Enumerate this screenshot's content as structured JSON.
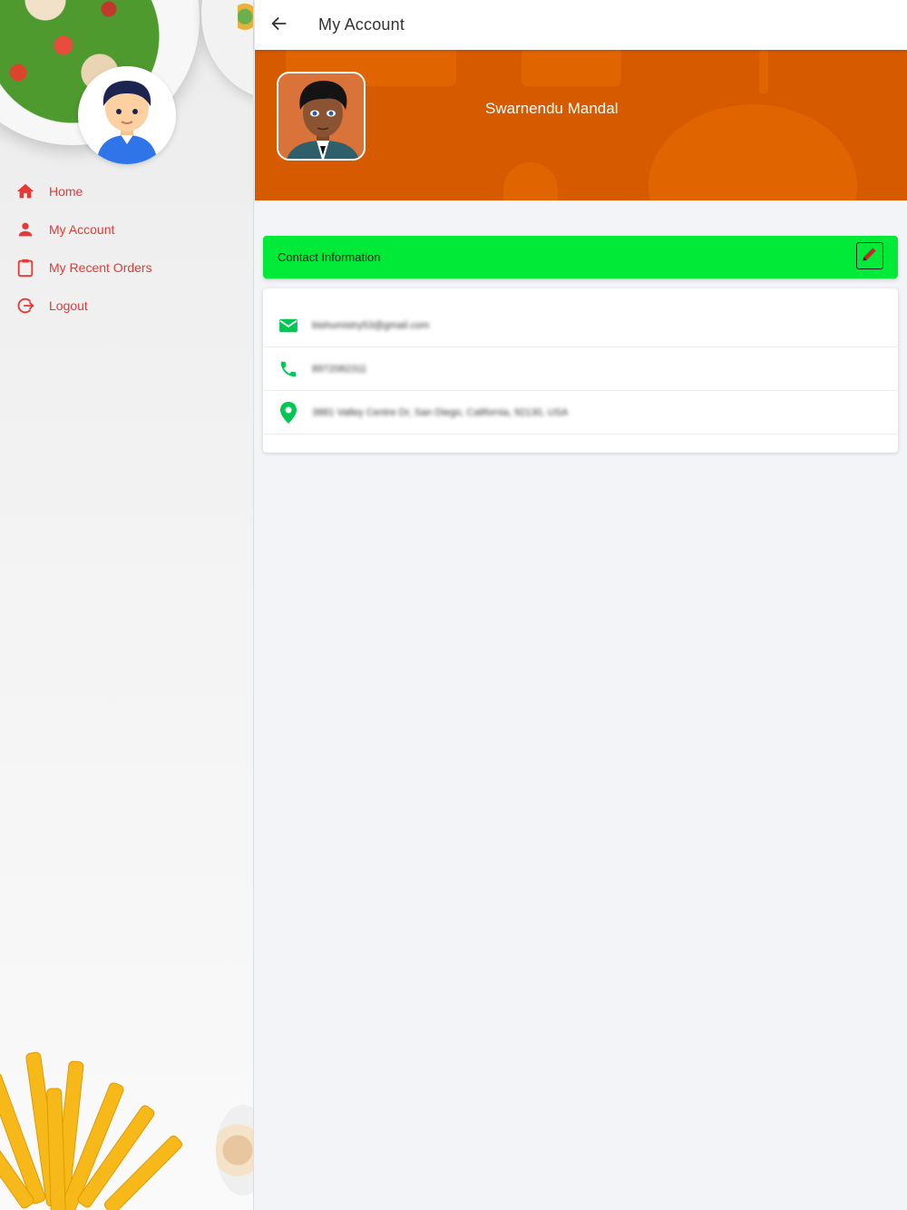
{
  "sidebar": {
    "items": [
      {
        "label": "Home",
        "icon": "home-icon"
      },
      {
        "label": "My Account",
        "icon": "person-icon"
      },
      {
        "label": "My Recent Orders",
        "icon": "clipboard-icon"
      },
      {
        "label": "Logout",
        "icon": "logout-icon"
      }
    ]
  },
  "header": {
    "title": "My Account",
    "back_icon": "arrow-left-icon"
  },
  "profile": {
    "name": "Swarnendu Mandal"
  },
  "contact": {
    "title": "Contact Information",
    "edit_icon": "pencil-icon",
    "email": "bishumistry53@gmail.com",
    "phone": "8972082311",
    "address": "3881 Valley Centre Dr, San Diego, California, 92130, USA"
  },
  "colors": {
    "accent_red": "#e53935",
    "banner_orange": "#d65a00",
    "contact_green": "#00ea37",
    "icon_green": "#00c853"
  }
}
